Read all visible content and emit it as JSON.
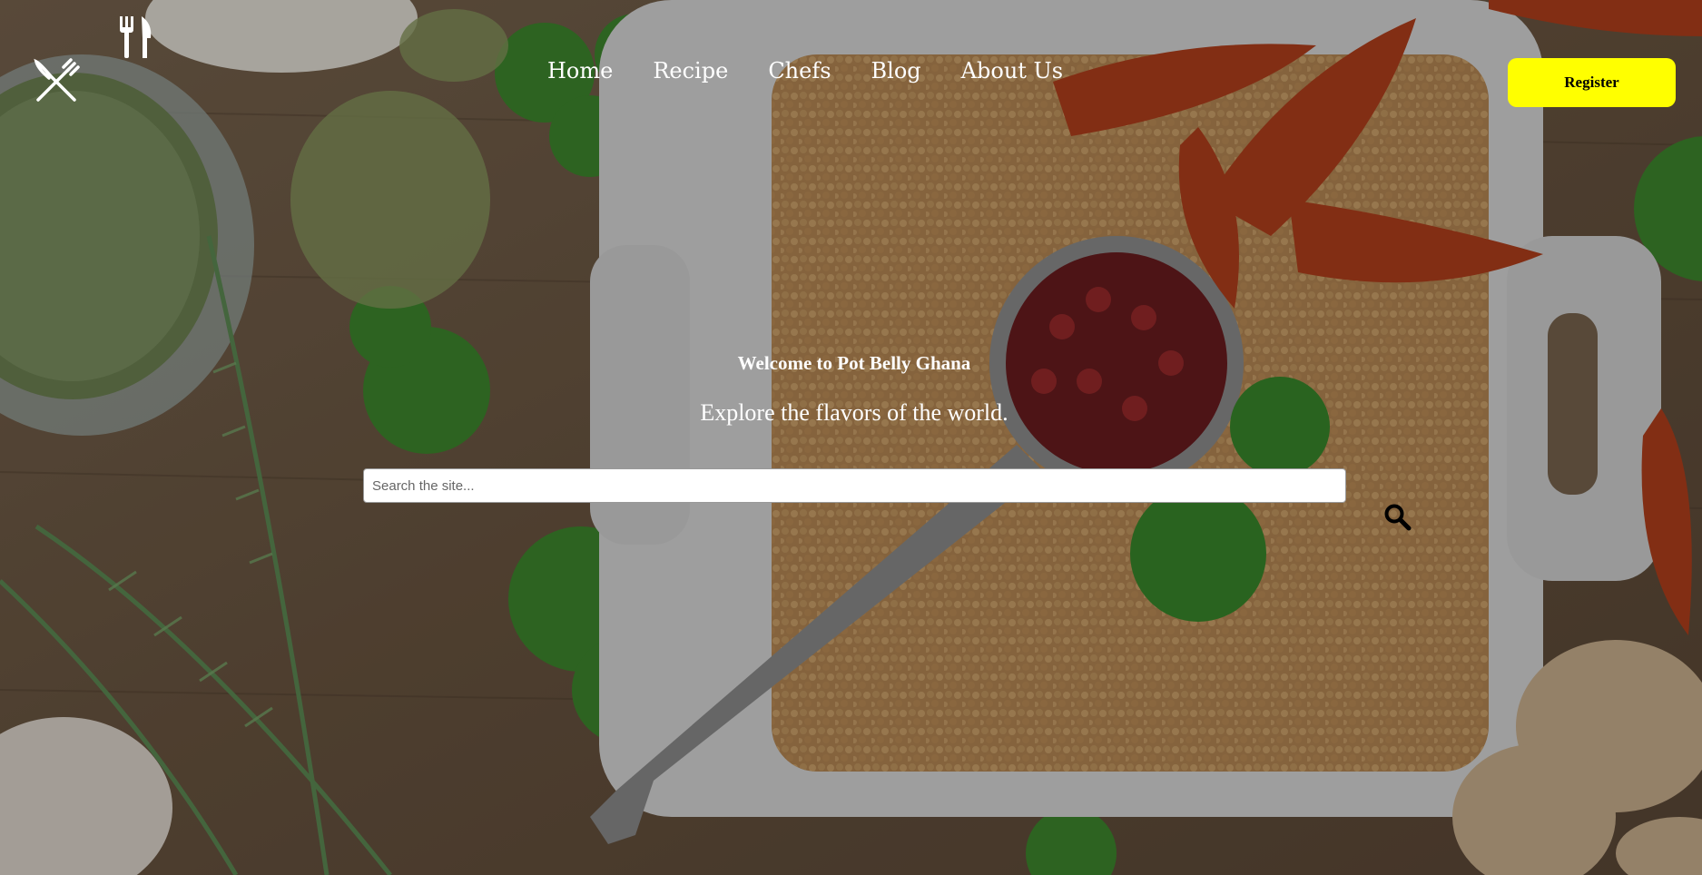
{
  "nav": {
    "items": [
      {
        "label": "Home"
      },
      {
        "label": "Recipe"
      },
      {
        "label": "Chefs"
      },
      {
        "label": "Blog"
      },
      {
        "label": "About Us"
      }
    ]
  },
  "header": {
    "register_label": "Register"
  },
  "hero": {
    "welcome": "Welcome to Pot Belly Ghana",
    "tagline": "Explore the flavors of the world."
  },
  "search": {
    "placeholder": "Search the site...",
    "value": ""
  },
  "colors": {
    "register_bg": "#ffff00",
    "text": "#ffffff"
  },
  "icons": {
    "logo": "crossed-fork-knife-icon",
    "secondary_logo": "fork-knife-icon",
    "search": "magnifier-icon"
  }
}
